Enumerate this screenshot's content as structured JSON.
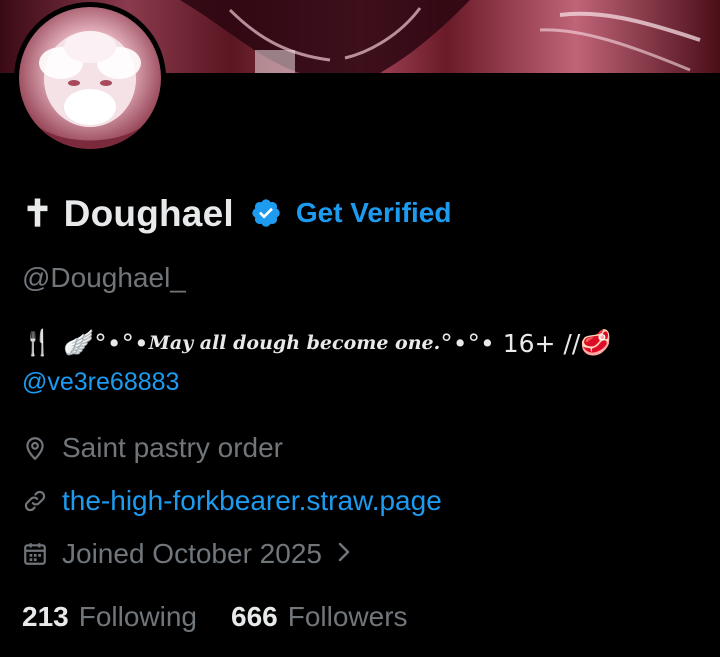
{
  "profile": {
    "display_name": "✝ Doughael",
    "get_verified_label": "Get Verified",
    "handle": "@Doughael_",
    "bio": {
      "fork_icon": "🍴",
      "wing_icon": "🪽",
      "deco_left": "°•°•",
      "script_text": "May all dough become one.",
      "deco_right": "°•°•",
      "age_text": " 16+ //",
      "meat_icon": "🥩",
      "mention": "@ve3re68883"
    },
    "location": "Saint pastry order",
    "website": "the-high-forkbearer.straw.page",
    "joined": "Joined October 2025",
    "stats": {
      "following_count": "213",
      "following_label": "Following",
      "followers_count": "666",
      "followers_label": "Followers"
    }
  },
  "colors": {
    "accent": "#1d9bf0",
    "muted": "#71767b",
    "text": "#e7e9ea",
    "background": "#000000"
  },
  "icons": {
    "location": "location-pin-icon",
    "website": "link-icon",
    "joined": "calendar-icon",
    "verified": "verified-badge-icon",
    "chevron": "chevron-right-icon"
  }
}
